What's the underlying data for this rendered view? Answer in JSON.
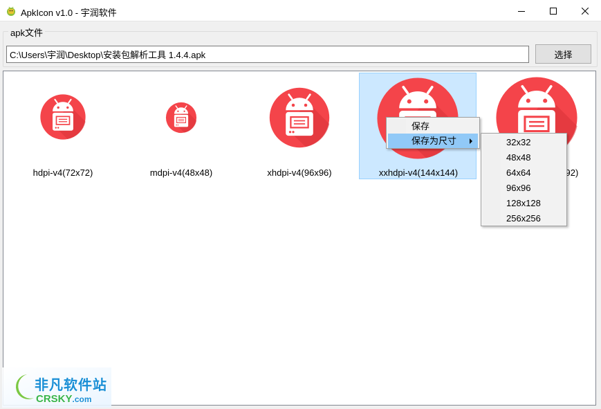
{
  "window": {
    "title": "ApkIcon v1.0 - 宇润软件",
    "controls": [
      "minimize-icon",
      "maximize-icon",
      "close-icon"
    ]
  },
  "apk_group": {
    "label": "apk文件",
    "path_value": "C:\\Users\\宇润\\Desktop\\安装包解析工具 1.4.4.apk",
    "select_label": "选择"
  },
  "icons": [
    {
      "label": "hdpi-v4(72x72)",
      "selected": false
    },
    {
      "label": "mdpi-v4(48x48)",
      "selected": false
    },
    {
      "label": "xhdpi-v4(96x96)",
      "selected": false
    },
    {
      "label": "xxhdpi-v4(144x144)",
      "selected": true
    },
    {
      "label": "xxxhdpi-v4(192x192)",
      "selected": false
    }
  ],
  "context_menu": {
    "items": [
      "保存",
      "保存为尺寸"
    ],
    "hover_index": 1
  },
  "size_submenu": {
    "items": [
      "32x32",
      "48x48",
      "64x64",
      "96x96",
      "128x128",
      "256x256"
    ]
  },
  "watermark": {
    "cn": "非凡软件站",
    "en": "CRSKY",
    "suffix": ".com"
  },
  "colors": {
    "icon_red": "#f4444a",
    "selection": "#cce8ff",
    "menu_hover": "#91c9f7"
  }
}
